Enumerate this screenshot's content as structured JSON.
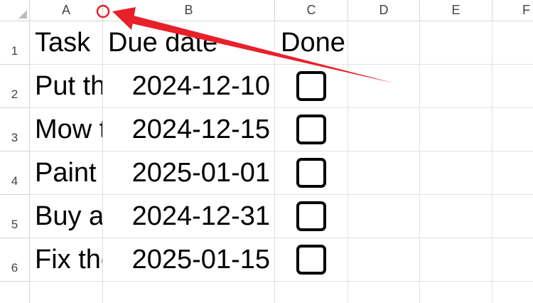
{
  "columns": [
    "A",
    "B",
    "C",
    "D",
    "E",
    "F"
  ],
  "rows": [
    "1",
    "2",
    "3",
    "4",
    "5",
    "6"
  ],
  "header_row": {
    "task": "Task",
    "due_date": "Due date",
    "done": "Done"
  },
  "tasks": [
    {
      "task": "Put the",
      "due": "2024-12-10",
      "done": false
    },
    {
      "task": "Mow the",
      "due": "2024-12-15",
      "done": false
    },
    {
      "task": "Paint the",
      "due": "2025-01-01",
      "done": false
    },
    {
      "task": "Buy a",
      "due": "2024-12-31",
      "done": false
    },
    {
      "task": "Fix the",
      "due": "2025-01-15",
      "done": false
    }
  ],
  "annotation": {
    "color": "#e8202a",
    "marker": "circle-at-column-boundary",
    "arrow": "red-arrow"
  }
}
